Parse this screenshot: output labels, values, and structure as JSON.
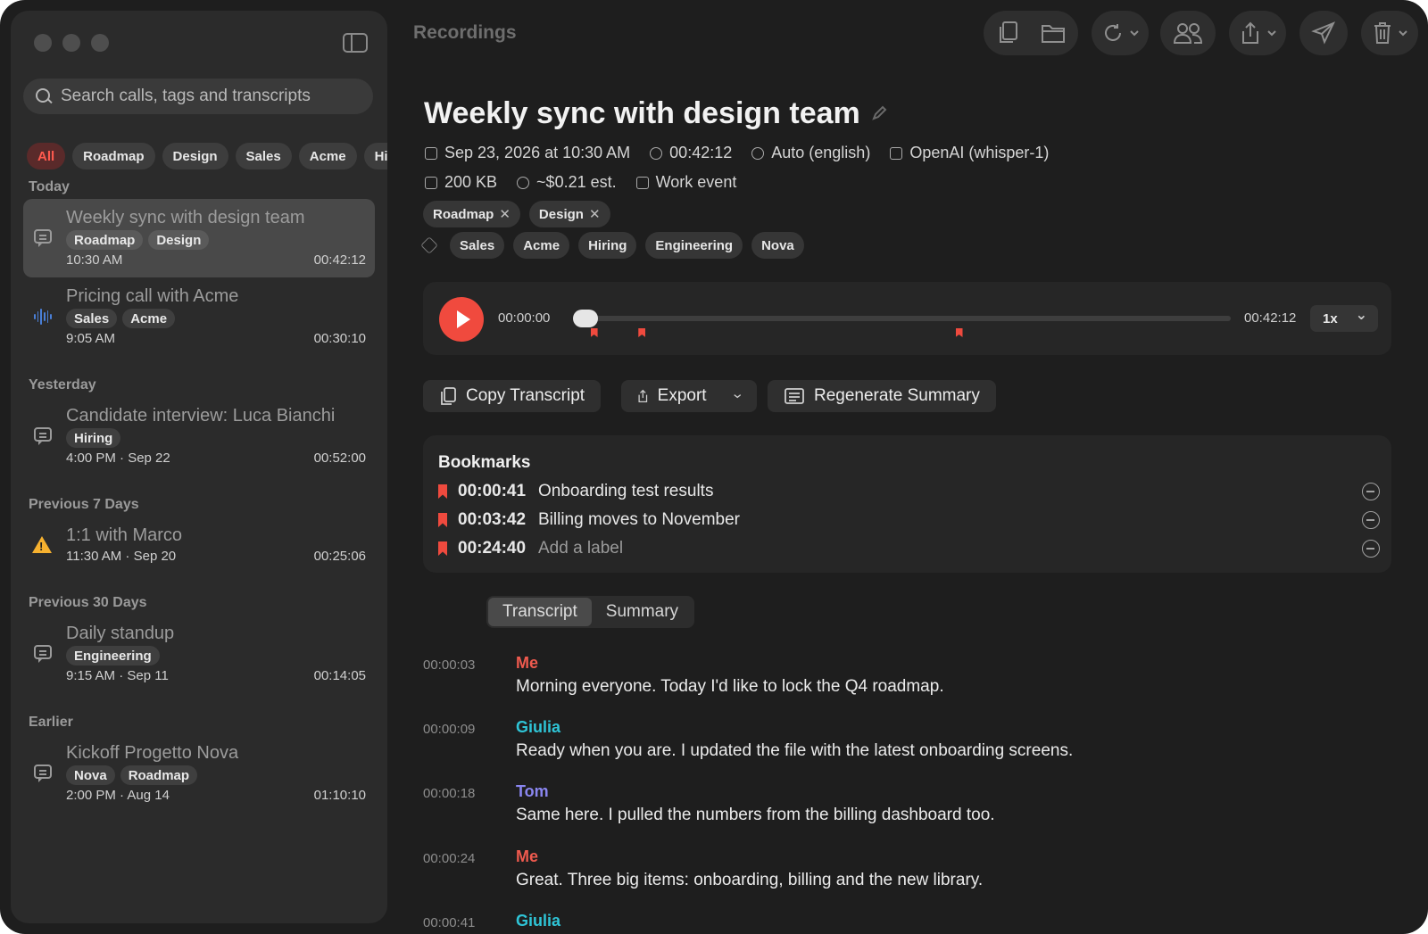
{
  "window": {
    "title": "Recordings"
  },
  "search": {
    "placeholder": "Search calls, tags and transcripts"
  },
  "filters": [
    "All",
    "Roadmap",
    "Design",
    "Sales",
    "Acme",
    "Hiri"
  ],
  "groups": [
    {
      "label": "Today",
      "items": [
        {
          "title": "Weekly sync with design team",
          "tags": [
            "Roadmap",
            "Design"
          ],
          "time": "10:30 AM",
          "duration": "00:42:12",
          "icon": "chat-icon",
          "selected": true
        },
        {
          "title": "Pricing call with Acme",
          "tags": [
            "Sales",
            "Acme"
          ],
          "time": "9:05 AM",
          "duration": "00:30:10",
          "icon": "waveform-icon"
        }
      ]
    },
    {
      "label": "Yesterday",
      "items": [
        {
          "title": "Candidate interview: Luca Bianchi",
          "tags": [
            "Hiring"
          ],
          "time": "4:00 PM · Sep 22",
          "duration": "00:52:00",
          "icon": "chat-icon"
        }
      ]
    },
    {
      "label": "Previous 7 Days",
      "items": [
        {
          "title": "1:1 with Marco",
          "tags": [],
          "time": "11:30 AM · Sep 20",
          "duration": "00:25:06",
          "icon": "warning-icon"
        }
      ]
    },
    {
      "label": "Previous 30 Days",
      "items": [
        {
          "title": "Daily standup",
          "tags": [
            "Engineering"
          ],
          "time": "9:15 AM · Sep 11",
          "duration": "00:14:05",
          "icon": "chat-icon"
        }
      ]
    },
    {
      "label": "Earlier",
      "items": [
        {
          "title": "Kickoff Progetto Nova",
          "tags": [
            "Nova",
            "Roadmap"
          ],
          "time": "2:00 PM · Aug 14",
          "duration": "01:10:10",
          "icon": "chat-icon"
        }
      ]
    }
  ],
  "recording": {
    "title": "Weekly sync with design team",
    "date": "Sep 23, 2026 at 10:30 AM",
    "duration": "00:42:12",
    "language": "Auto (english)",
    "model": "OpenAI (whisper-1)",
    "size": "200 KB",
    "cost": "~$0.21 est.",
    "event": "Work event",
    "applied_tags": [
      "Roadmap",
      "Design"
    ],
    "suggested_tags": [
      "Sales",
      "Acme",
      "Hiring",
      "Engineering",
      "Nova"
    ]
  },
  "player": {
    "current": "00:00:00",
    "total": "00:42:12",
    "speed": "1x",
    "progress": 0,
    "markers": [
      0.016,
      0.09,
      0.58
    ]
  },
  "actions": {
    "copy": "Copy Transcript",
    "export": "Export",
    "regenerate": "Regenerate Summary"
  },
  "bookmarks": {
    "title": "Bookmarks",
    "items": [
      {
        "time": "00:00:41",
        "label": "Onboarding test results",
        "placeholder": false
      },
      {
        "time": "00:03:42",
        "label": "Billing moves to November",
        "placeholder": false
      },
      {
        "time": "00:24:40",
        "label": "Add a label",
        "placeholder": true
      }
    ]
  },
  "tabs": {
    "transcript": "Transcript",
    "summary": "Summary"
  },
  "transcript": [
    {
      "time": "00:00:03",
      "speaker": "Me",
      "color": "#ef5a4e",
      "text": "Morning everyone. Today I'd like to lock the Q4 roadmap."
    },
    {
      "time": "00:00:09",
      "speaker": "Giulia",
      "color": "#2fc4d6",
      "text": "Ready when you are. I updated the file with the latest onboarding screens."
    },
    {
      "time": "00:00:18",
      "speaker": "Tom",
      "color": "#8a86f0",
      "text": "Same here. I pulled the numbers from the billing dashboard too."
    },
    {
      "time": "00:00:24",
      "speaker": "Me",
      "color": "#ef5a4e",
      "text": "Great. Three big items: onboarding, billing and the new library."
    },
    {
      "time": "00:00:41",
      "speaker": "Giulia",
      "color": "#2fc4d6",
      "text": ""
    }
  ]
}
